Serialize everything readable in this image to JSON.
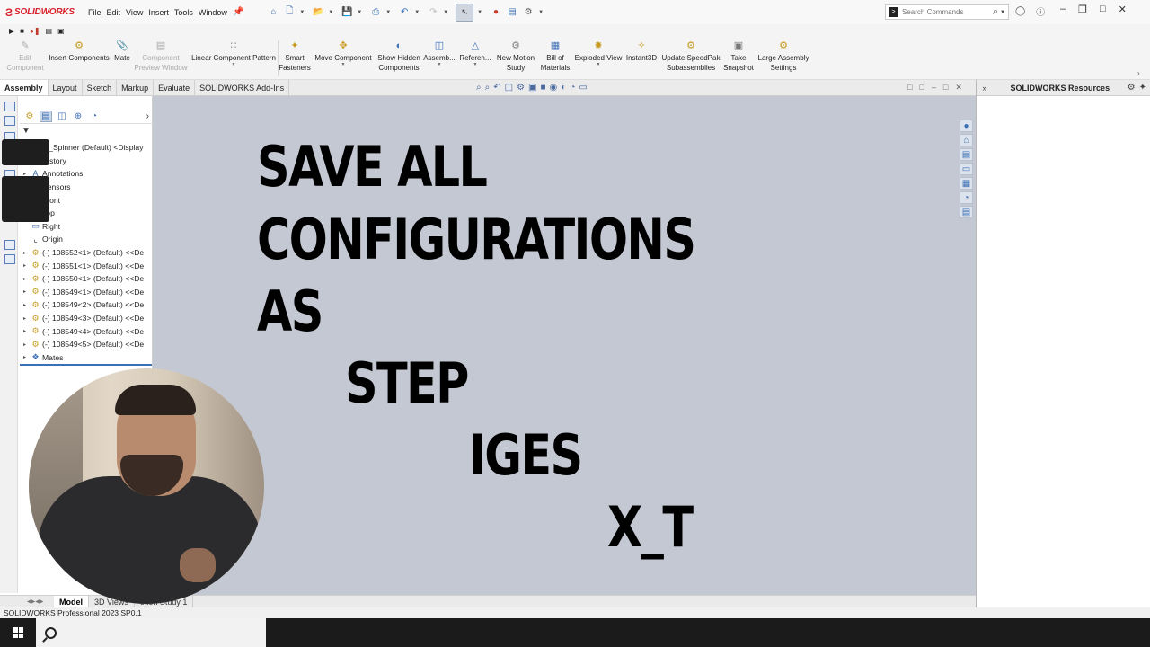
{
  "app": {
    "ds_mark": "Ƨ",
    "brand": "SOLIDWORKS"
  },
  "menu": [
    "File",
    "Edit",
    "View",
    "Insert",
    "Tools",
    "Window"
  ],
  "search": {
    "placeholder": "Search Commands"
  },
  "ribbon": [
    {
      "line1": "Edit",
      "line2": "Component",
      "disabled": true,
      "icon": "pencil-icon"
    },
    {
      "line1": "Insert Components",
      "line2": "",
      "disabled": false,
      "icon": "insert-components-icon"
    },
    {
      "line1": "Mate",
      "line2": "",
      "disabled": false,
      "icon": "paperclip-icon"
    },
    {
      "line1": "Component",
      "line2": "Preview Window",
      "disabled": true,
      "icon": "preview-window-icon"
    },
    {
      "line1": "Linear Component Pattern",
      "line2": "",
      "disabled": false,
      "icon": "pattern-icon"
    },
    {
      "line1": "Smart",
      "line2": "Fasteners",
      "disabled": false,
      "icon": "fastener-icon"
    },
    {
      "line1": "Move Component",
      "line2": "",
      "disabled": false,
      "icon": "move-icon"
    },
    {
      "line1": "Show Hidden",
      "line2": "Components",
      "disabled": false,
      "icon": "show-hidden-icon"
    },
    {
      "line1": "Assemb...",
      "line2": "",
      "disabled": false,
      "icon": "assembly-features-icon"
    },
    {
      "line1": "Referen...",
      "line2": "",
      "disabled": false,
      "icon": "reference-geometry-icon"
    },
    {
      "line1": "New Motion",
      "line2": "Study",
      "disabled": false,
      "icon": "motion-study-icon"
    },
    {
      "line1": "Bill of",
      "line2": "Materials",
      "disabled": false,
      "icon": "bom-icon"
    },
    {
      "line1": "Exploded View",
      "line2": "",
      "disabled": false,
      "icon": "exploded-view-icon"
    },
    {
      "line1": "Instant3D",
      "line2": "",
      "disabled": false,
      "icon": "instant3d-icon"
    },
    {
      "line1": "Update SpeedPak",
      "line2": "Subassemblies",
      "disabled": false,
      "icon": "speedpak-icon"
    },
    {
      "line1": "Take",
      "line2": "Snapshot",
      "disabled": false,
      "icon": "camera-icon"
    },
    {
      "line1": "Large Assembly",
      "line2": "Settings",
      "disabled": false,
      "icon": "large-assembly-icon"
    }
  ],
  "tabs": [
    "Assembly",
    "Layout",
    "Sketch",
    "Markup",
    "Evaluate",
    "SOLIDWORKS Add-Ins"
  ],
  "active_tab": "Assembly",
  "tree": [
    {
      "label": "et_Spinner (Default) <Display",
      "expand": "",
      "icon": "assembly-icon"
    },
    {
      "label": "History",
      "expand": "",
      "icon": "history-icon"
    },
    {
      "label": "Annotations",
      "expand": "▸",
      "icon": "annotations-icon"
    },
    {
      "label": "Sensors",
      "expand": "",
      "icon": "sensors-icon"
    },
    {
      "label": "Front",
      "expand": "",
      "icon": "plane-icon"
    },
    {
      "label": "Top",
      "expand": "",
      "icon": "plane-icon"
    },
    {
      "label": "Right",
      "expand": "",
      "icon": "plane-icon"
    },
    {
      "label": "Origin",
      "expand": "",
      "icon": "origin-icon"
    },
    {
      "label": "(-) 108552<1> (Default) <<De",
      "expand": "▸",
      "icon": "part-icon"
    },
    {
      "label": "(-) 108551<1> (Default) <<De",
      "expand": "▸",
      "icon": "part-icon"
    },
    {
      "label": "(-) 108550<1> (Default) <<De",
      "expand": "▸",
      "icon": "part-icon"
    },
    {
      "label": "(-) 108549<1> (Default) <<De",
      "expand": "▸",
      "icon": "part-icon"
    },
    {
      "label": "(-) 108549<2> (Default) <<De",
      "expand": "▸",
      "icon": "part-icon"
    },
    {
      "label": "(-) 108549<3> (Default) <<De",
      "expand": "▸",
      "icon": "part-icon"
    },
    {
      "label": "(-) 108549<4> (Default) <<De",
      "expand": "▸",
      "icon": "part-icon"
    },
    {
      "label": "(-) 108549<5> (Default) <<De",
      "expand": "▸",
      "icon": "part-icon"
    },
    {
      "label": "Mates",
      "expand": "▸",
      "icon": "mates-icon"
    }
  ],
  "overlay": {
    "line1": "SAVE ALL",
    "line2": "CONFIGURATIONS",
    "line3": "AS",
    "line4": "STEP",
    "line5": "IGES",
    "line6": "X_T"
  },
  "taskpane": {
    "title": "SOLIDWORKS Resources"
  },
  "model_tabs": [
    "Model",
    "3D Views",
    "otion Study 1"
  ],
  "active_model_tab": "Model",
  "status": "SOLIDWORKS Professional 2023 SP0.1",
  "colors": {
    "graphics_bg": "#c3c8d2",
    "accent": "#3b6fb6",
    "brand_red": "#d81e2a"
  }
}
